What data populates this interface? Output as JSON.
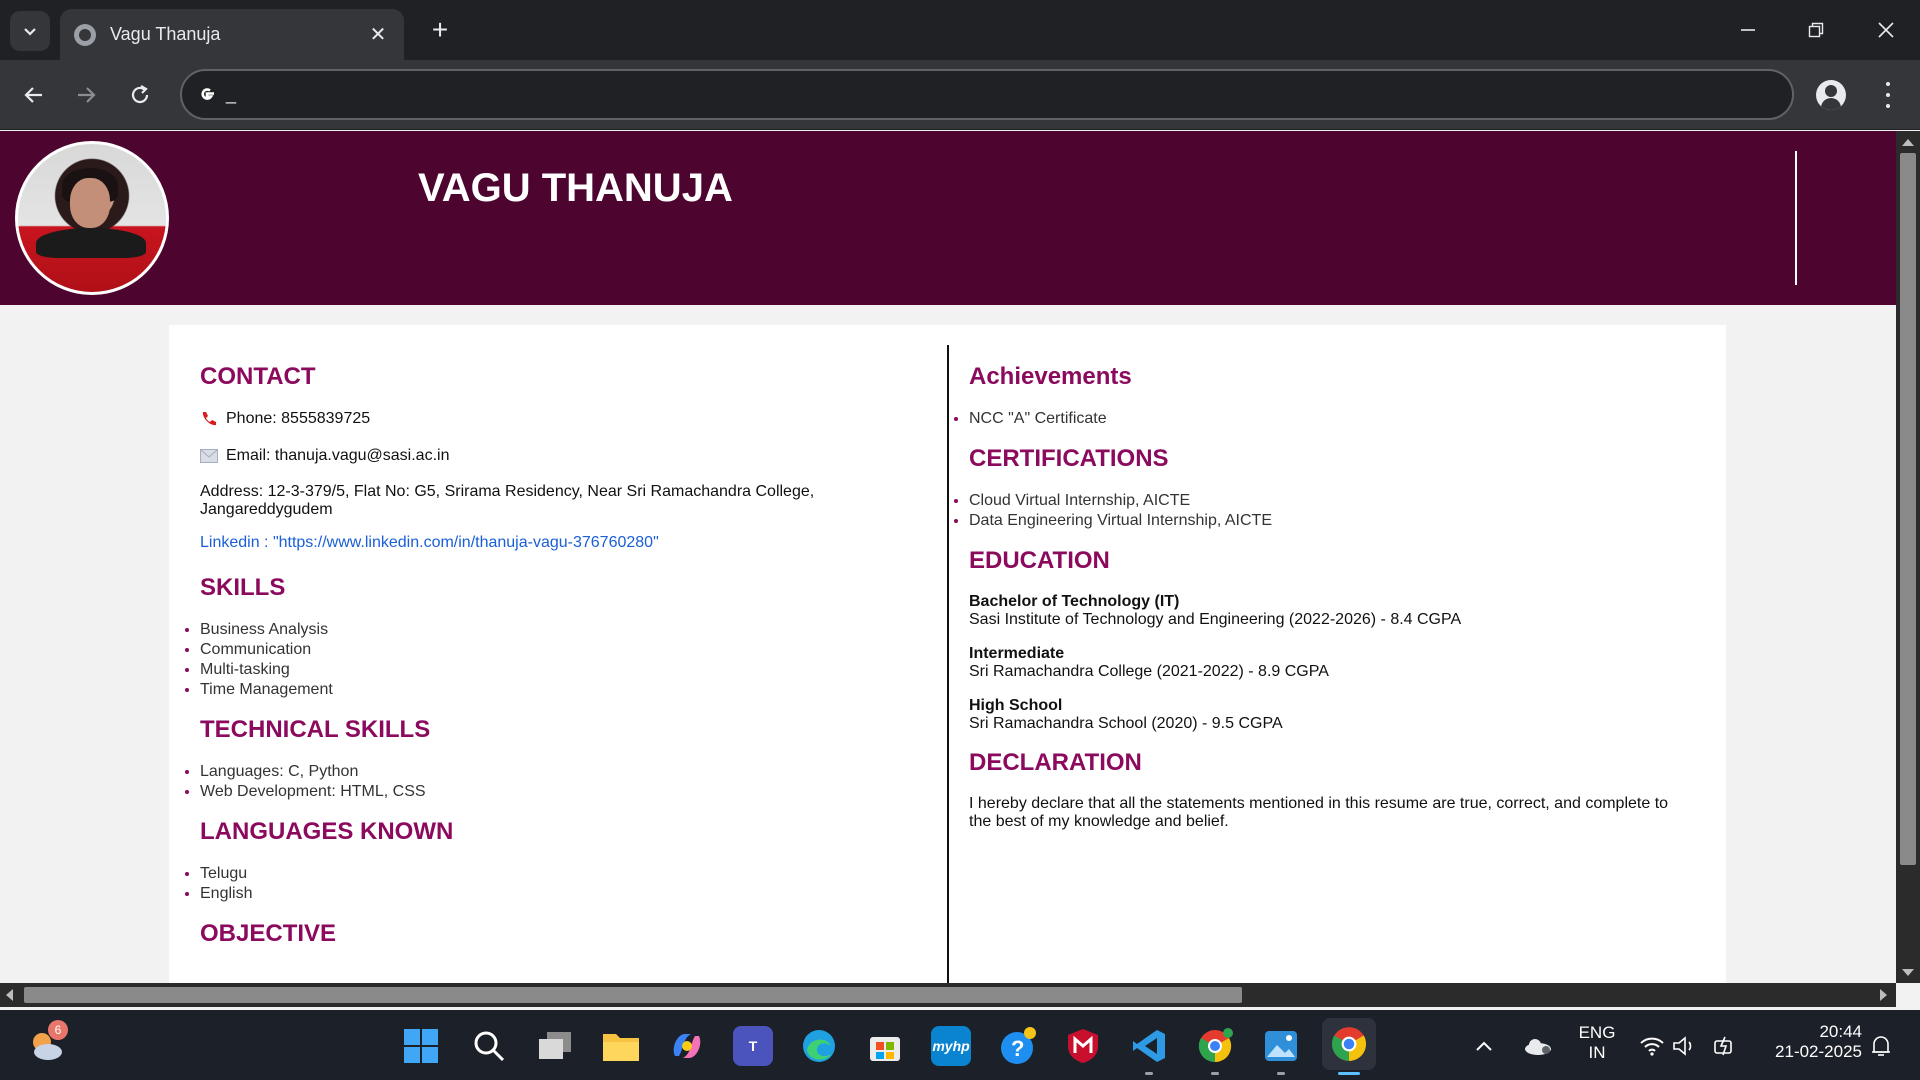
{
  "browser": {
    "tab_title": "Vagu Thanuja",
    "tab_close": "✕",
    "new_tab": "+",
    "address_text": "_",
    "window_controls": {
      "minimize": "—",
      "restore": "❐",
      "close": "✕"
    }
  },
  "resume": {
    "name": "VAGU THANUJA",
    "contact": {
      "heading": "CONTACT",
      "phone": "Phone: 8555839725",
      "email": "Email: thanuja.vagu@sasi.ac.in",
      "address": "Address: 12-3-379/5, Flat No: G5, Srirama Residency, Near Sri Ramachandra College, Jangareddygudem",
      "linkedin": "Linkedin : \"https://www.linkedin.com/in/thanuja-vagu-376760280\""
    },
    "skills": {
      "heading": "SKILLS",
      "items": [
        "Business Analysis",
        "Communication",
        "Multi-tasking",
        "Time Management"
      ]
    },
    "technical_skills": {
      "heading": "TECHNICAL SKILLS",
      "items": [
        "Languages: C, Python",
        "Web Development: HTML, CSS"
      ]
    },
    "languages": {
      "heading": "LANGUAGES KNOWN",
      "items": [
        "Telugu",
        "English"
      ]
    },
    "objective": {
      "heading": "OBJECTIVE"
    },
    "achievements": {
      "heading": "Achievements",
      "items": [
        "NCC \"A\" Certificate"
      ]
    },
    "certifications": {
      "heading": "CERTIFICATIONS",
      "items": [
        "Cloud Virtual Internship, AICTE",
        "Data Engineering Virtual Internship, AICTE"
      ]
    },
    "education": {
      "heading": "EDUCATION",
      "entries": [
        {
          "degree": "Bachelor of Technology (IT)",
          "detail": "Sasi Institute of Technology and Engineering (2022-2026) - 8.4 CGPA"
        },
        {
          "degree": "Intermediate",
          "detail": "Sri Ramachandra College (2021-2022) - 8.9 CGPA"
        },
        {
          "degree": "High School",
          "detail": "Sri Ramachandra School (2020) - 9.5 CGPA"
        }
      ]
    },
    "declaration": {
      "heading": "DECLARATION",
      "text": "I hereby declare that all the statements mentioned in this resume are true, correct, and complete to the best of my knowledge and belief."
    }
  },
  "taskbar": {
    "weather_badge": "6",
    "myhp_label": "myhp",
    "teams_label": "T",
    "language": "ENG",
    "region": "IN",
    "time": "20:44",
    "date": "21-02-2025"
  }
}
